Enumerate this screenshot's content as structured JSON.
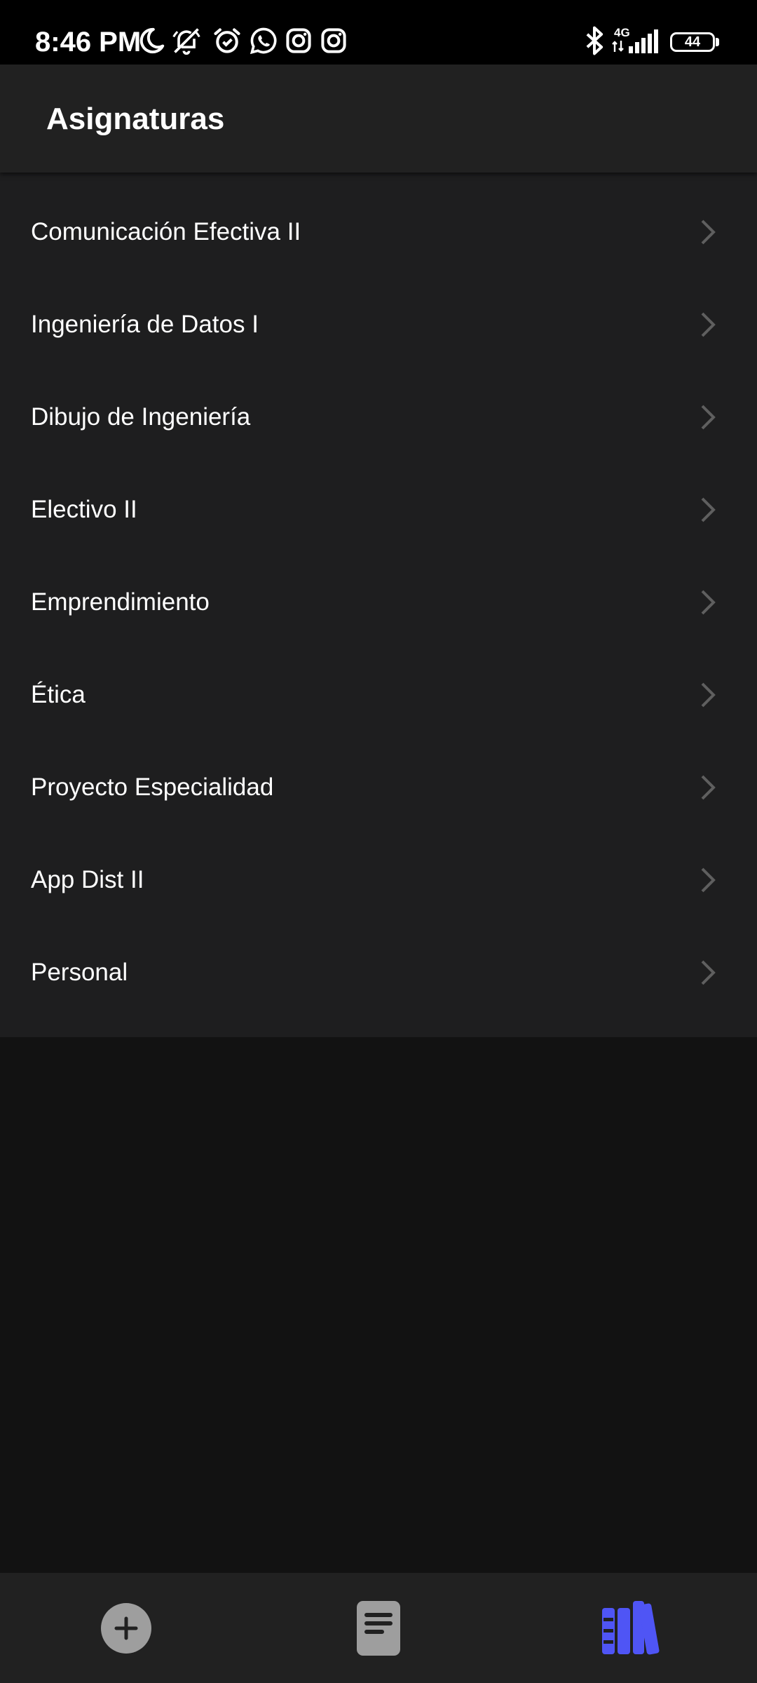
{
  "status_bar": {
    "time": "8:46 PM",
    "network_type": "4G",
    "battery_level": "44",
    "icons": [
      "moon-icon",
      "bell-off-icon",
      "alarm-icon",
      "whatsapp-icon",
      "instagram-icon",
      "instagram-icon",
      "bluetooth-icon",
      "signal-icon",
      "battery-icon"
    ]
  },
  "app_bar": {
    "title": "Asignaturas"
  },
  "subjects": [
    {
      "label": "Comunicación Efectiva II"
    },
    {
      "label": "Ingeniería de Datos I"
    },
    {
      "label": "Dibujo de Ingeniería"
    },
    {
      "label": "Electivo II"
    },
    {
      "label": "Emprendimiento"
    },
    {
      "label": "Ética"
    },
    {
      "label": "Proyecto Especialidad"
    },
    {
      "label": "App Dist II"
    },
    {
      "label": "Personal"
    }
  ],
  "bottom_nav": {
    "items": [
      {
        "icon": "add-circle-icon",
        "active": false
      },
      {
        "icon": "document-icon",
        "active": false
      },
      {
        "icon": "library-icon",
        "active": true
      }
    ]
  },
  "colors": {
    "background": "#121212",
    "surface": "#1e1e1f",
    "app_bar": "#212121",
    "accent": "#4f55f5",
    "inactive_icon": "#9e9e9e",
    "chevron": "#5f5f5f"
  }
}
